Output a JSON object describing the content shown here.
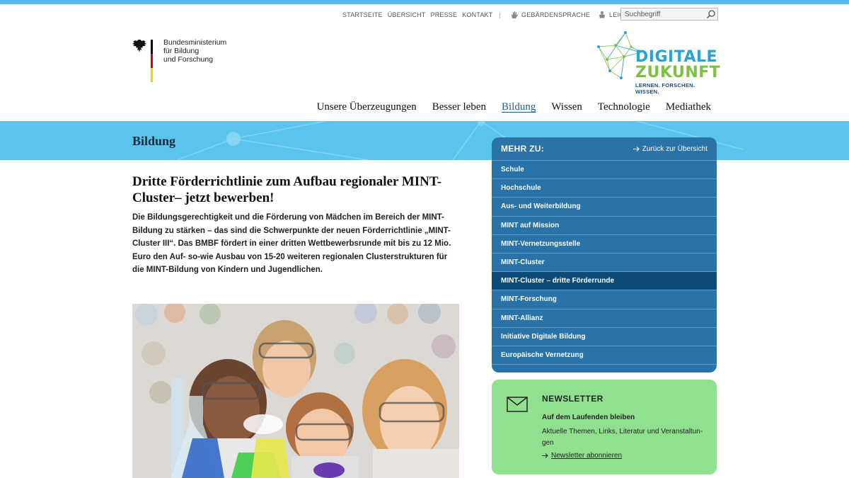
{
  "service_nav": {
    "links": [
      "STARTSEITE",
      "ÜBERSICHT",
      "PRESSE",
      "KONTAKT"
    ],
    "separator": "|",
    "sign_language": "GEBÄRDENSPRACHE",
    "easy_language": "LEICHTE SPRACHE",
    "search_placeholder": "Suchbegriff"
  },
  "ministry": {
    "line1": "Bundesministerium",
    "line2": "für Bildung",
    "line3": "und Forschung"
  },
  "dz_logo": {
    "line1": "DIGITALE",
    "line2": "ZUKUNFT",
    "tagline": "LERNEN. FORSCHEN. WISSEN."
  },
  "main_nav": {
    "items": [
      "Unsere Überzeugungen",
      "Besser leben",
      "Bildung",
      "Wissen",
      "Technologie",
      "Mediathek"
    ],
    "active": "Bildung"
  },
  "banner": {
    "title": "Bildung"
  },
  "article": {
    "title": "Dritte Förderrichtlinie zum Aufbau regionaler MINT-Cluster– jetzt bewerben!",
    "lead": "Die Bildungsgerechtigkeit und die Förderung von Mädchen im Bereich der MINT-Bildung zu stärken – das sind die Schwerpunkte der neuen Förderrichtlinie „MINT-Cluster III“. Das BMBF fördert in einer dritten Wettbewerbsrunde mit bis zu 12 Mio. Euro den Auf- so-wie Ausbau von 15-20 weiteren regionalen Clusterstrukturen für die MINT-Bildung von Kindern und Jugendlichen."
  },
  "sidebar": {
    "title": "MEHR ZU:",
    "back_label": "Zurück zur Übersicht",
    "items": [
      "Schule",
      "Hochschule",
      "Aus- und Weiterbildung",
      "MINT auf Mission",
      "MINT-Vernetzungsstelle",
      "MINT-Cluster",
      "MINT-Cluster – dritte Förderrunde",
      "MINT-Forschung",
      "MINT-Allianz",
      "Initiative Digitale Bildung",
      "Europäische Vernetzung"
    ],
    "active_index": 6
  },
  "newsletter": {
    "title": "NEWSLETTER",
    "subtitle": "Auf dem Laufenden bleiben",
    "text": "Aktuelle Themen, Links, Literatur und Veranstaltun-gen",
    "link_label": "Newsletter abonnieren"
  },
  "colors": {
    "accent_blue": "#2a73a8",
    "active_blue": "#0c4a78",
    "banner_blue": "#5ac4ec",
    "newsletter_green": "#90e090",
    "dz_blue": "#29a3d4",
    "dz_green": "#7dc142"
  }
}
